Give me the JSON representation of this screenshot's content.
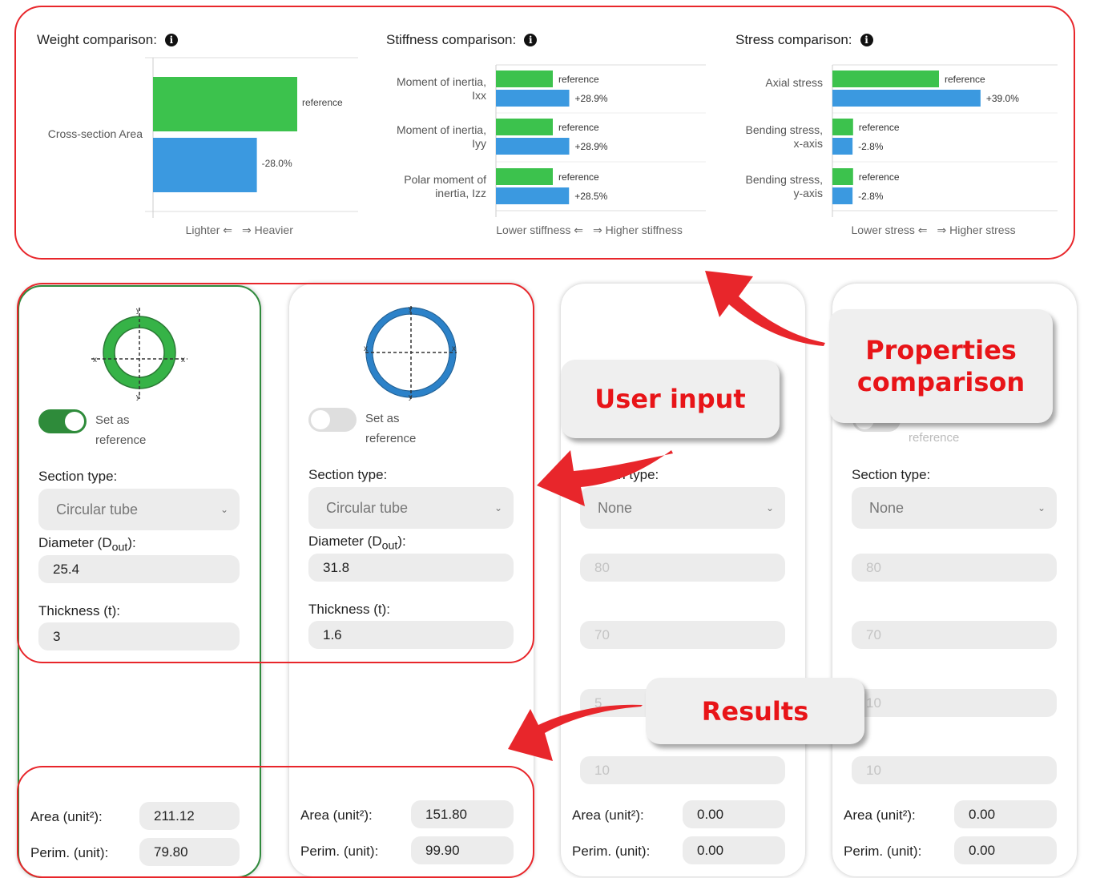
{
  "weight_chart": {
    "title": "Weight comparison:",
    "categories": [
      "Cross-section  Area"
    ],
    "series": [
      {
        "label": "reference",
        "value": 100,
        "color": "#3cc24d"
      },
      {
        "label": "-28.0%",
        "value": 72.0,
        "color": "#3b99e0"
      }
    ],
    "left_axis_label": "Lighter ⇐",
    "right_axis_label": "⇒ Heavier"
  },
  "stiffness_chart": {
    "title": "Stiffness comparison:",
    "categories": [
      {
        "line1": "Moment of inertia,",
        "line2": "Ixx"
      },
      {
        "line1": "Moment of inertia,",
        "line2": "Iyy"
      },
      {
        "line1": "Polar moment  of",
        "line2": "inertia, Izz"
      }
    ],
    "reference_values": [
      100,
      100,
      100
    ],
    "compare_values": [
      128.9,
      128.9,
      128.5
    ],
    "reference_labels": [
      "reference",
      "reference",
      "reference"
    ],
    "compare_labels": [
      "+28.9%",
      "+28.9%",
      "+28.5%"
    ],
    "left_axis_label": "Lower stiffness ⇐",
    "right_axis_label": "⇒ Higher stiffness"
  },
  "stress_chart": {
    "title": "Stress comparison:",
    "categories": [
      {
        "line1": "Axial stress",
        "line2": ""
      },
      {
        "line1": "Bending stress,",
        "line2": "x-axis"
      },
      {
        "line1": "Bending stress,",
        "line2": "y-axis"
      }
    ],
    "reference_values": [
      100,
      19.4,
      19.4
    ],
    "compare_values": [
      139.0,
      18.9,
      18.9
    ],
    "reference_labels": [
      "reference",
      "reference",
      "reference"
    ],
    "compare_labels": [
      "+39.0%",
      "-2.8%",
      "-2.8%"
    ],
    "left_axis_label": "Lower stress ⇐",
    "right_axis_label": "⇒ Higher stress"
  },
  "chart_data": [
    {
      "type": "bar",
      "title": "Weight comparison:",
      "categories": [
        "Cross-section  Area"
      ],
      "series": [
        {
          "name": "reference",
          "values": [
            100
          ]
        },
        {
          "name": "-28.0%",
          "values": [
            72.0
          ]
        }
      ],
      "xlabel": "Lighter ⇐   ⇒ Heavier",
      "orientation": "horizontal"
    },
    {
      "type": "bar",
      "title": "Stiffness comparison:",
      "categories": [
        "Moment of inertia, Ixx",
        "Moment of inertia, Iyy",
        "Polar moment  of inertia, Izz"
      ],
      "series": [
        {
          "name": "reference",
          "values": [
            100,
            100,
            100
          ]
        },
        {
          "values": [
            128.9,
            128.9,
            128.5
          ]
        }
      ],
      "data_labels": [
        "+28.9%",
        "+28.9%",
        "+28.5%"
      ],
      "xlabel": "Lower stiffness ⇐   ⇒ Higher stiffness",
      "orientation": "horizontal"
    },
    {
      "type": "bar",
      "title": "Stress comparison:",
      "categories": [
        "Axial stress",
        "Bending stress, x-axis",
        "Bending stress, y-axis"
      ],
      "series": [
        {
          "name": "reference",
          "values": [
            100,
            19.4,
            19.4
          ]
        },
        {
          "values": [
            139.0,
            18.9,
            18.9
          ]
        }
      ],
      "data_labels": [
        "+39.0%",
        "-2.8%",
        "-2.8%"
      ],
      "xlabel": "Lower stress ⇐   ⇒ Higher stress",
      "orientation": "horizontal"
    }
  ],
  "colors": {
    "reference_bar": "#3cc24d",
    "compare_bar": "#3b99e0",
    "annotation": "#e8262b"
  },
  "cards": [
    {
      "section_color": "#36b347",
      "toggle_on": true,
      "set_as_line1": "Set as",
      "set_as_line2": "reference",
      "section_label": "Section type:",
      "section_value": "Circular tube",
      "diameter_label": "Diameter (D",
      "diameter_sub": "out",
      "diameter_suffix": "):",
      "diameter_value": "25.4",
      "thickness_label": "Thickness (t):",
      "thickness_value": "3",
      "area_label": "Area (unit²):",
      "area_value": "211.12",
      "perim_label": "Perim. (unit):",
      "perim_value": "79.80"
    },
    {
      "section_color": "#2c82c9",
      "toggle_on": false,
      "set_as_line1": "Set as",
      "set_as_line2": "reference",
      "section_label": "Section type:",
      "section_value": "Circular tube",
      "diameter_label": "Diameter (D",
      "diameter_sub": "out",
      "diameter_suffix": "):",
      "diameter_value": "31.8",
      "thickness_label": "Thickness (t):",
      "thickness_value": "1.6",
      "area_label": "Area (unit²):",
      "area_value": "151.80",
      "perim_label": "Perim. (unit):",
      "perim_value": "99.90"
    },
    {
      "section_label": "Section type:",
      "section_value": "None",
      "field1_value": "80",
      "field2_value": "70",
      "field3_value": "5",
      "field4_value": "10",
      "area_label": "Area (unit²):",
      "area_value": "0.00",
      "perim_label": "Perim. (unit):",
      "perim_value": "0.00"
    },
    {
      "ref_text": "reference",
      "section_label": "Section type:",
      "section_value": "None",
      "field1_value": "80",
      "field2_value": "70",
      "field3_value": "10",
      "field4_value": "10",
      "area_label": "Area (unit²):",
      "area_value": "0.00",
      "perim_label": "Perim. (unit):",
      "perim_value": "0.00"
    }
  ],
  "annotations": {
    "properties_line1": "Properties",
    "properties_line2": "comparison",
    "user_input": "User input",
    "results": "Results"
  },
  "axis_glyphs": {
    "x": "x",
    "y": "y"
  }
}
